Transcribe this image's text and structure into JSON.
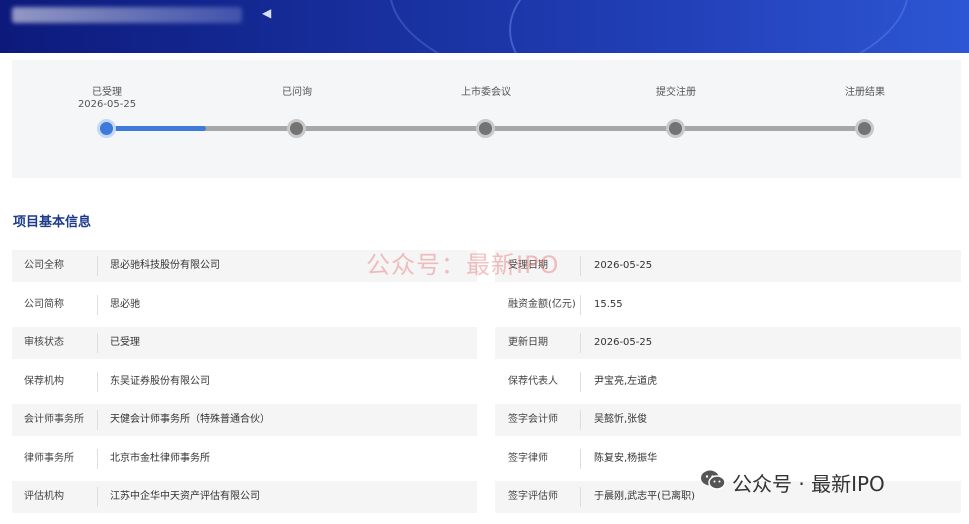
{
  "banner": {
    "glyph": "◀"
  },
  "progress": {
    "current_step_fraction": 0.13,
    "steps": [
      {
        "label": "已受理",
        "date": "2026-05-25",
        "active": true
      },
      {
        "label": "已问询",
        "date": "",
        "active": false
      },
      {
        "label": "上市委会议",
        "date": "",
        "active": false
      },
      {
        "label": "提交注册",
        "date": "",
        "active": false
      },
      {
        "label": "注册结果",
        "date": "",
        "active": false
      }
    ]
  },
  "section": {
    "title": "项目基本信息"
  },
  "left_rows": [
    {
      "label": "公司全称",
      "value": "思必驰科技股份有限公司"
    },
    {
      "label": "公司简称",
      "value": "思必驰"
    },
    {
      "label": "审核状态",
      "value": "已受理"
    },
    {
      "label": "保荐机构",
      "value": "东吴证券股份有限公司"
    },
    {
      "label": "会计师事务所",
      "value": "天健会计师事务所（特殊普通合伙）"
    },
    {
      "label": "律师事务所",
      "value": "北京市金杜律师事务所"
    },
    {
      "label": "评估机构",
      "value": "江苏中企华中天资产评估有限公司"
    }
  ],
  "right_rows": [
    {
      "label": "受理日期",
      "value": "2026-05-25"
    },
    {
      "label": "融资金额(亿元)",
      "value": "15.55"
    },
    {
      "label": "更新日期",
      "value": "2026-05-25"
    },
    {
      "label": "保荐代表人",
      "value": "尹宝亮,左道虎"
    },
    {
      "label": "签字会计师",
      "value": "吴懿忻,张俊"
    },
    {
      "label": "签字律师",
      "value": "陈复安,杨振华"
    },
    {
      "label": "签字评估师",
      "value": "于晨刚,武志平(已离职)"
    }
  ],
  "watermark": {
    "text": "公众号：最新IPO"
  },
  "wechat_badge": {
    "text": "公众号 · 最新IPO",
    "icon": "wechat-icon"
  },
  "colors": {
    "banner": "#18309e",
    "accent": "#3e7ad9",
    "title": "#1d3b8a",
    "node": "#737373"
  }
}
